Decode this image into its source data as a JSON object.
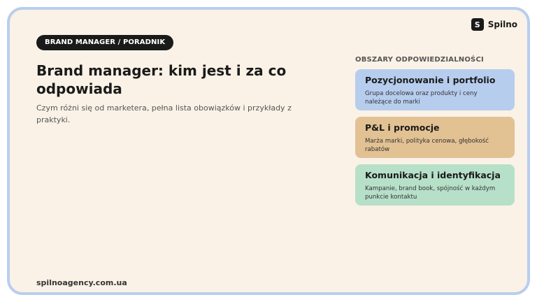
{
  "brand": {
    "mark": "S",
    "name": "Spilno"
  },
  "badge": "BRAND MANAGER / PORADNIK",
  "title": "Brand manager: kim jest i za co odpowiada",
  "subtitle": "Czym różni się od marketera, pełna lista obowiązków i przykłady z praktyki.",
  "footer": {
    "url": "spilnoagency.com.ua"
  },
  "panel": {
    "heading": "OBSZARY ODPOWIEDZIALNOŚCI",
    "cards": [
      {
        "title": "Pozycjonowanie i portfolio",
        "desc": "Grupa docelowa oraz produkty i ceny należące do marki",
        "color": "#b7cdee"
      },
      {
        "title": "P&L i promocje",
        "desc": "Marża marki, polityka cenowa, głębokość rabatów",
        "color": "#e2c193"
      },
      {
        "title": "Komunikacja i identyfikacja",
        "desc": "Kampanie, brand book, spójność w każdym punkcie kontaktu",
        "color": "#b7e0c9"
      }
    ]
  },
  "colors": {
    "background": "#faf2e7",
    "frame": "#b9cdee",
    "badge": "#1a1a1a"
  }
}
